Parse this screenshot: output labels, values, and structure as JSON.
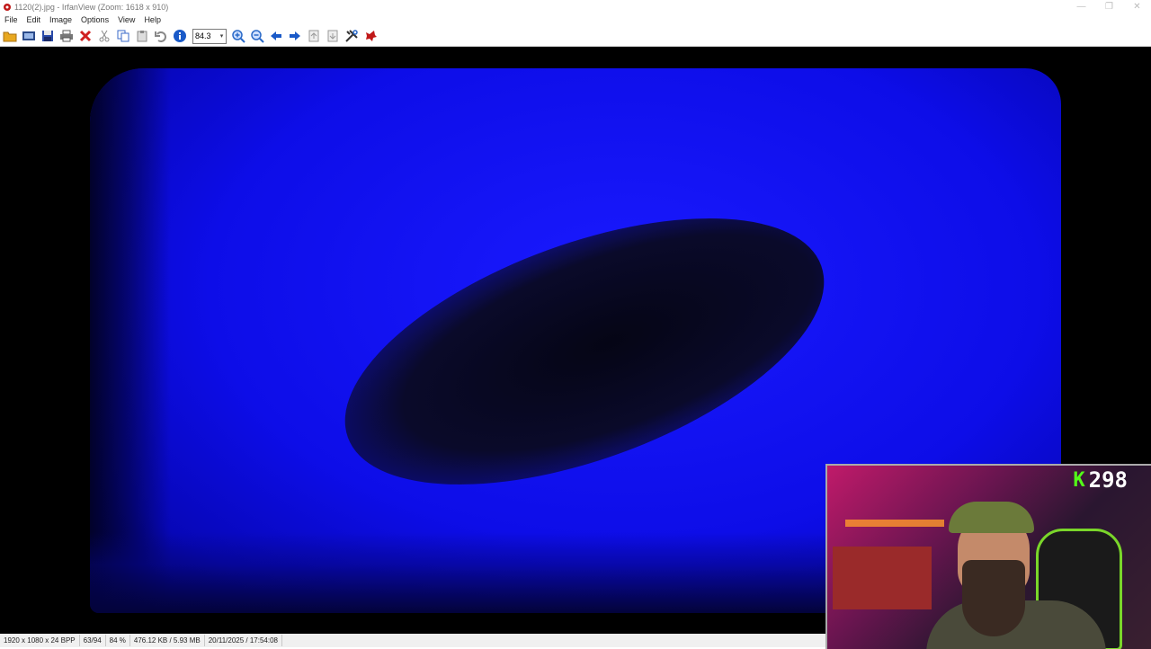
{
  "window": {
    "title": "1120(2).jpg - IrfanView (Zoom: 1618 x 910)",
    "controls": {
      "minimize": "—",
      "maximize": "❐",
      "close": "✕"
    }
  },
  "menu": {
    "items": [
      "File",
      "Edit",
      "Image",
      "Options",
      "View",
      "Help"
    ]
  },
  "toolbar": {
    "zoom_value": "84.3",
    "buttons": [
      {
        "name": "open-folder-icon",
        "color": "#e8a820"
      },
      {
        "name": "thumbnails-icon",
        "color": "#2a4a8a"
      },
      {
        "name": "save-icon",
        "color": "#2a4aa8"
      },
      {
        "name": "print-icon",
        "color": "#555555"
      },
      {
        "name": "delete-icon",
        "color": "#d02020"
      },
      {
        "name": "cut-icon",
        "color": "#888888"
      },
      {
        "name": "copy-icon",
        "color": "#3a6ac8"
      },
      {
        "name": "paste-icon",
        "color": "#888888"
      },
      {
        "name": "undo-icon",
        "color": "#888888"
      },
      {
        "name": "info-icon",
        "color": "#1a5ac8"
      }
    ],
    "buttons_after": [
      {
        "name": "zoom-in-icon",
        "color": "#2a6ac8"
      },
      {
        "name": "zoom-out-icon",
        "color": "#2a6ac8"
      },
      {
        "name": "previous-icon",
        "color": "#1a5ac8"
      },
      {
        "name": "next-icon",
        "color": "#1a5ac8"
      },
      {
        "name": "first-page-icon",
        "color": "#999999"
      },
      {
        "name": "last-page-icon",
        "color": "#999999"
      },
      {
        "name": "settings-icon",
        "color": "#333333"
      },
      {
        "name": "irfanview-icon",
        "color": "#c01818"
      }
    ]
  },
  "statusbar": {
    "dimensions": "1920 x 1080 x 24 BPP",
    "index": "63/94",
    "zoom": "84 %",
    "size": "476.12 KB / 5.93 MB",
    "datetime": "20/11/2025 / 17:54:08"
  },
  "overlay": {
    "counter": "298",
    "counter_color": "#53fc18"
  }
}
